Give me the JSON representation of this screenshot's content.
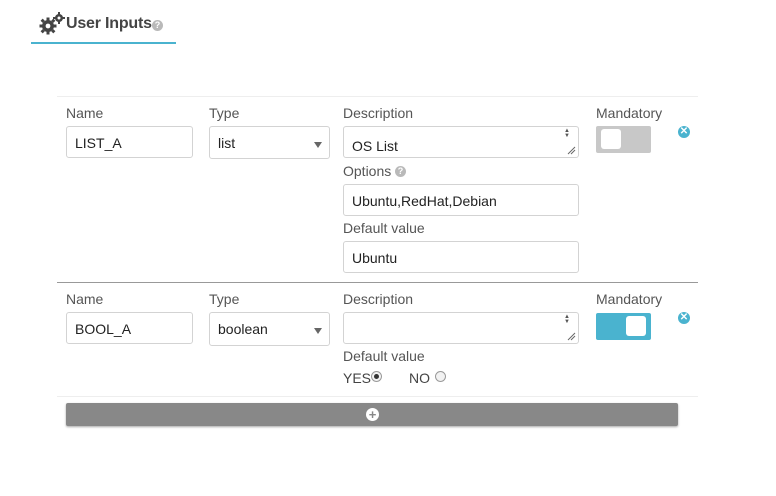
{
  "header": {
    "title": "User Inputs",
    "help_icon": "?"
  },
  "labels": {
    "name": "Name",
    "type": "Type",
    "description": "Description",
    "mandatory": "Mandatory",
    "options": "Options",
    "default_value": "Default value"
  },
  "inputs": [
    {
      "name": "LIST_A",
      "type": "list",
      "description": "OS List",
      "options": "Ubuntu,RedHat,Debian",
      "default_value": "Ubuntu",
      "mandatory": false
    },
    {
      "name": "BOOL_A",
      "type": "boolean",
      "description": "",
      "mandatory": true,
      "default_choices": [
        {
          "label": "YES",
          "selected": true
        },
        {
          "label": "NO",
          "selected": false
        }
      ]
    }
  ],
  "colors": {
    "accent": "#4ab3cf",
    "toggle_off": "#c8c8c8",
    "add_button": "#888888"
  },
  "icons": {
    "header": "gears-icon",
    "remove": "remove-circle-icon",
    "add": "plus-circle-icon"
  }
}
